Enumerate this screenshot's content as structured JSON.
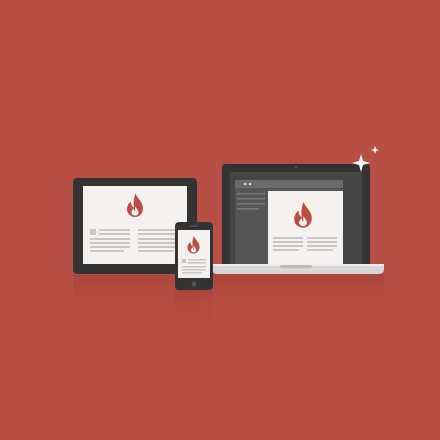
{
  "scene": {
    "background_color": "#b94f44",
    "accent_color": "#b94f44",
    "device_frame_color": "#333333",
    "screen_color": "#f4f1ef",
    "text_line_color": "#c9c5c2",
    "sparkle_color": "#ffffff",
    "devices": [
      {
        "name": "tablet",
        "icon": "flame-icon",
        "orientation": "landscape"
      },
      {
        "name": "phone",
        "icon": "flame-icon",
        "orientation": "portrait"
      },
      {
        "name": "laptop",
        "icon": "flame-icon",
        "window": "browser-with-sidebar"
      }
    ],
    "decorations": [
      "sparkle-icon"
    ]
  }
}
